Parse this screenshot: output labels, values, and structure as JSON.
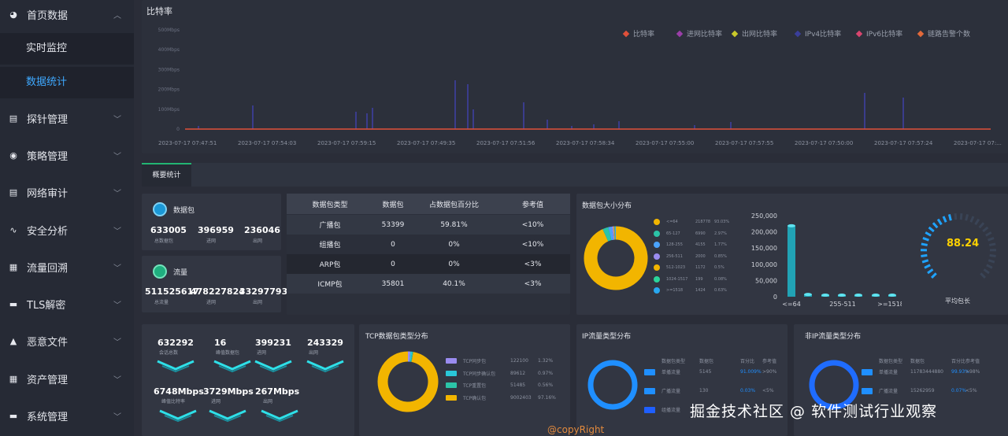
{
  "sidebar": {
    "items": [
      {
        "label": "首页数据",
        "icon": "pie-icon",
        "expanded": true
      },
      {
        "label": "探针管理",
        "icon": "document-icon"
      },
      {
        "label": "策略管理",
        "icon": "target-icon"
      },
      {
        "label": "网络审计",
        "icon": "document-icon"
      },
      {
        "label": "安全分析",
        "icon": "pulse-icon"
      },
      {
        "label": "流量回溯",
        "icon": "database-icon"
      },
      {
        "label": "TLS解密",
        "icon": "monitor-icon"
      },
      {
        "label": "恶意文件",
        "icon": "warning-icon"
      },
      {
        "label": "资产管理",
        "icon": "database-icon"
      },
      {
        "label": "系统管理",
        "icon": "monitor-icon"
      }
    ],
    "subitems": [
      "实时监控",
      "数据统计"
    ],
    "active_subitem": "数据统计",
    "accent": "#3fa9ff"
  },
  "bitrate": {
    "title": "比特率",
    "legend": [
      {
        "name": "比特率",
        "color": "#e0503a"
      },
      {
        "name": "进网比特率",
        "color": "#9a3ea8"
      },
      {
        "name": "出网比特率",
        "color": "#c9c92a"
      },
      {
        "name": "IPv4比特率",
        "color": "#3a3e99"
      },
      {
        "name": "IPv6比特率",
        "color": "#d8456e"
      },
      {
        "name": "链路告警个数",
        "color": "#e2693a"
      }
    ],
    "y_ticks": [
      "500Mbps",
      "400Mbps",
      "300Mbps",
      "200Mbps",
      "100Mbps",
      "0"
    ],
    "x_ticks": [
      "2023-07-17 07:47:51",
      "2023-07-17 07:54:03",
      "2023-07-17 07:59:15",
      "2023-07-17 07:49:35",
      "2023-07-17 07:51:56",
      "2023-07-17 07:58:34",
      "2023-07-17 07:55:00",
      "2023-07-17 07:57:55",
      "2023-07-17 07:50:00",
      "2023-07-17 07:57:24",
      "2023-07-17 07:..."
    ]
  },
  "tabs": {
    "overview": "概要统计"
  },
  "packets": {
    "title": "数据包",
    "total": "633005",
    "total_label": "总数据包",
    "in": "396959",
    "in_label": "进网",
    "out": "236046",
    "out_label": "出网"
  },
  "traffic": {
    "title": "流量",
    "total": "511525617",
    "total_label": "总流量",
    "in": "478227824",
    "in_label": "进网",
    "out": "33297793",
    "out_label": "出网"
  },
  "packet_table": {
    "headers": [
      "数据包类型",
      "数据包",
      "占数据包百分比",
      "参考值"
    ],
    "rows": [
      [
        "广播包",
        "53399",
        "59.81%",
        "<10%"
      ],
      [
        "组播包",
        "0",
        "0%",
        "<10%"
      ],
      [
        "ARP包",
        "0",
        "0%",
        "<3%"
      ],
      [
        "ICMP包",
        "35801",
        "40.1%",
        "<3%"
      ]
    ]
  },
  "size_dist": {
    "title": "数据包大小分布",
    "legend": [
      {
        "name": "<=64",
        "count": "218778",
        "pct": "93.03%",
        "color": "#f2b500"
      },
      {
        "name": "65-127",
        "count": "6990",
        "pct": "2.97%",
        "color": "#2bc4a8"
      },
      {
        "name": "128-255",
        "count": "4155",
        "pct": "1.77%",
        "color": "#4aa3ff"
      },
      {
        "name": "256-511",
        "count": "2000",
        "pct": "0.85%",
        "color": "#9a8cf0"
      },
      {
        "name": "512-1023",
        "count": "1172",
        "pct": "0.5%",
        "color": "#f2b500"
      },
      {
        "name": "1024-1517",
        "count": "199",
        "pct": "0.08%",
        "color": "#2bd49a"
      },
      {
        "name": ">=1518",
        "count": "1424",
        "pct": "0.63%",
        "color": "#28a8f0"
      }
    ],
    "y_ticks": [
      "250,000",
      "200,000",
      "150,000",
      "100,000",
      "50,000",
      "0"
    ],
    "x_ticks": [
      "<=64",
      "255-511",
      ">=1518"
    ],
    "bar_values": [
      218778,
      6990,
      4155,
      2000,
      1172,
      199,
      1424
    ],
    "avg_value": "88.24",
    "avg_label": "平均包长"
  },
  "session_stats": {
    "row1": [
      {
        "value": "632292",
        "label": "会话总数"
      },
      {
        "value": "16",
        "label": "峰值数据包"
      },
      {
        "value": "399231",
        "label": "进网"
      },
      {
        "value": "243329",
        "label": "出网"
      }
    ],
    "row2": [
      {
        "value": "6748Mbps",
        "label": "峰值比特率"
      },
      {
        "value": "3729Mbps",
        "label": "进网"
      },
      {
        "value": "267Mbps",
        "label": "出网"
      }
    ]
  },
  "tcp_dist": {
    "title": "TCP数据包类型分布",
    "legend": [
      {
        "name": "TCP同步包",
        "count": "122100",
        "pct": "1.32%",
        "color": "#9a8cf0"
      },
      {
        "name": "TCP同步确认包",
        "count": "89612",
        "pct": "0.97%",
        "color": "#29c7d8"
      },
      {
        "name": "TCP重置包",
        "count": "51485",
        "pct": "0.56%",
        "color": "#2bc4a8"
      },
      {
        "name": "TCP确认包",
        "count": "9002403",
        "pct": "97.16%",
        "color": "#f2b500"
      }
    ]
  },
  "ip_dist": {
    "title": "IP流量类型分布",
    "headers": [
      "数据包类型",
      "数据包",
      "百分比",
      "参考值"
    ],
    "rows": [
      {
        "type": "单播流量",
        "count": "5145",
        "pct": "91.009%",
        "ref": ">90%",
        "color": "#1f8fff"
      },
      {
        "type": "广播流量",
        "count": "130",
        "pct": "0.03%",
        "ref": "<5%",
        "color": "#1f8fff"
      },
      {
        "type": "组播流量",
        "count": "",
        "pct": "",
        "ref": "",
        "color": "#1f5fff"
      }
    ]
  },
  "nonip_dist": {
    "title": "非IP流量类型分布",
    "headers": [
      "数据包类型",
      "数据包",
      "百分比",
      "参考值"
    ],
    "rows": [
      {
        "type": "单播流量",
        "count": "11783444880",
        "pct": "99.93%",
        "ref": ">98%",
        "color": "#1f8fff"
      },
      {
        "type": "广播流量",
        "count": "15262959",
        "pct": "0.07%",
        "ref": "<5%",
        "color": "#1f8fff"
      }
    ]
  },
  "footer": {
    "copyright": "@copyRight"
  },
  "watermark": "掘金技术社区 @ 软件测试行业观察"
}
